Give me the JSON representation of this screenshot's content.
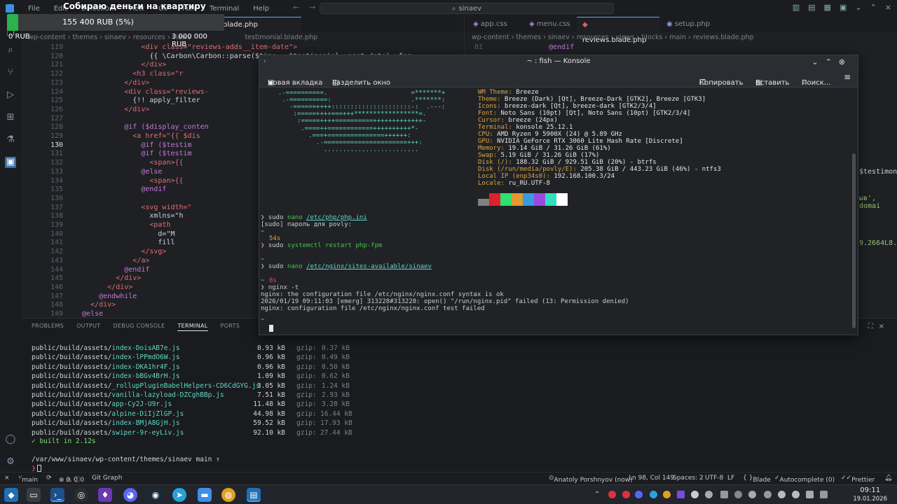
{
  "titlebar": {
    "menu": [
      "File",
      "Edit",
      "Selection",
      "View",
      "Go",
      "Run",
      "Terminal",
      "Help"
    ],
    "command_center": "sinaev"
  },
  "donation": {
    "title": "Собираю деньги на квартиру",
    "progress_text": "155 400 RUB (5%)",
    "progress_fraction": 0.0518,
    "min": "0 RUB",
    "max": "3 000 000 RUB"
  },
  "editor_left": {
    "tab_active": "testimonial.blade.php",
    "tab_partial": "blade.php",
    "breadcrumb": [
      "wp-content",
      "themes",
      "sinaev",
      "resources",
      "views",
      "...",
      "testimonial.blade.php"
    ],
    "lines": [
      {
        "n": "119",
        "code": "                <div class=\"reviews-adds__item-date\">"
      },
      {
        "n": "120",
        "code": "                  {{ \\Carbon\\Carbon::parse($time,  $testimonial->post_date)->for"
      },
      {
        "n": "121",
        "code": "                </div>"
      },
      {
        "n": "122",
        "code": "              <h3 class=\"r"
      },
      {
        "n": "123",
        "code": "            </div>"
      },
      {
        "n": "124",
        "code": "            <div class=\"reviews-"
      },
      {
        "n": "125",
        "code": "              {!! apply_filter"
      },
      {
        "n": "126",
        "code": "            </div>"
      },
      {
        "n": "127",
        "code": ""
      },
      {
        "n": "128",
        "code": "            @if ($display_conten"
      },
      {
        "n": "129",
        "code": "              <a href=\"{{ $dis"
      },
      {
        "n": "130",
        "code": "                @if ($testim"
      },
      {
        "n": "131",
        "code": "                @if ($testim"
      },
      {
        "n": "132",
        "code": "                  <span>{{"
      },
      {
        "n": "133",
        "code": "                @else"
      },
      {
        "n": "134",
        "code": "                  <span>{{"
      },
      {
        "n": "135",
        "code": "                @endif"
      },
      {
        "n": "136",
        "code": ""
      },
      {
        "n": "137",
        "code": "                <svg width=\""
      },
      {
        "n": "138",
        "code": "                  xmlns=\"h"
      },
      {
        "n": "139",
        "code": "                  <path"
      },
      {
        "n": "140",
        "code": "                    d=\"M"
      },
      {
        "n": "141",
        "code": "                    fill"
      },
      {
        "n": "142",
        "code": "                </svg>"
      },
      {
        "n": "143",
        "code": "              </a>"
      },
      {
        "n": "144",
        "code": "            @endif"
      },
      {
        "n": "145",
        "code": "          </div>"
      },
      {
        "n": "146",
        "code": "        </div>"
      },
      {
        "n": "147",
        "code": "      @endwhile"
      },
      {
        "n": "148",
        "code": "    </div>"
      },
      {
        "n": "149",
        "code": "  @else"
      }
    ]
  },
  "editor_right": {
    "tabs": [
      "app.css",
      "menu.css",
      "reviews.blade.php",
      "setup.php"
    ],
    "active_tab": "reviews.blade.php",
    "breadcrumb": [
      "wp-content",
      "themes",
      "sinaev",
      "resources",
      "views",
      "blocks",
      "main",
      "reviews.blade.php"
    ],
    "line_81_n": "81",
    "line_81": "@endif",
    "fragment_1": "$testimoni",
    "fragment_2": "ыв', domai",
    "fragment_3": "9.2664L8.4"
  },
  "panel": {
    "tabs": [
      "PROBLEMS",
      "OUTPUT",
      "DEBUG CONSOLE",
      "TERMINAL",
      "PORTS"
    ],
    "active_tab": "TERMINAL",
    "build_rows": [
      {
        "dir": "public/build/assets/",
        "file": "index-DoisAB7e.js",
        "size": "0.93 kB",
        "gzip": "0.37 kB"
      },
      {
        "dir": "public/build/assets/",
        "file": "index-lPPmdO6W.js",
        "size": "0.96 kB",
        "gzip": "0.49 kB"
      },
      {
        "dir": "public/build/assets/",
        "file": "index-DKA1hr4F.js",
        "size": "0.96 kB",
        "gzip": "0.50 kB"
      },
      {
        "dir": "public/build/assets/",
        "file": "index-bBGv4BrH.js",
        "size": "1.09 kB",
        "gzip": "0.62 kB"
      },
      {
        "dir": "public/build/assets/",
        "file": "_rollupPluginBabelHelpers-CD6CdGYG.js",
        "size": "3.05 kB",
        "gzip": "1.24 kB"
      },
      {
        "dir": "public/build/assets/",
        "file": "vanilla-lazyload-DZCghBBp.js",
        "size": "7.51 kB",
        "gzip": "2.93 kB"
      },
      {
        "dir": "public/build/assets/",
        "file": "app-Cy2J-U9r.js",
        "size": "11.48 kB",
        "gzip": "3.28 kB"
      },
      {
        "dir": "public/build/assets/",
        "file": "alpine-DiIjZlGP.js",
        "size": "44.98 kB",
        "gzip": "16.44 kB"
      },
      {
        "dir": "public/build/assets/",
        "file": "index-BMjA8GjH.js",
        "size": "59.52 kB",
        "gzip": "17.93 kB"
      },
      {
        "dir": "public/build/assets/",
        "file": "swiper-9r-eyLiv.js",
        "size": "92.10 kB",
        "gzip": "27.44 kB"
      }
    ],
    "gzip_label": "gzip:",
    "built": "✓ built in 2.12s",
    "cwd": "/var/www/sinaev/wp-content/themes/sinaev main ↑",
    "prompt": "❯"
  },
  "konsole": {
    "title": "~ : fish — Konsole",
    "toolbar": {
      "new_tab": "Новая вкладка",
      "split": "Разделить окно",
      "copy": "Копировать",
      "paste": "Вставить",
      "search": "Поиск..."
    },
    "ascii": [
      "  .-==========.                      =*******+",
      "   .-==========:                     .*******:",
      "     -======++++:::::::::::::::::::::-:  .---:",
      "      :=====++++===+++*****************=.",
      "       :=====++++==========+++++++++++++-",
      "        .====++============++++++++++*-",
      "          .===+===============++++++:",
      "            .-======================+++:",
      "              ........................."
    ],
    "fastfetch": [
      {
        "k": "WM Theme:",
        "v": "Breeze"
      },
      {
        "k": "Theme:",
        "v": "Breeze (Dark) [Qt], Breeze-Dark [GTK2], Breeze [GTK3]"
      },
      {
        "k": "Icons:",
        "v": "breeze-dark [Qt], breeze-dark [GTK2/3/4]"
      },
      {
        "k": "Font:",
        "v": "Noto Sans (10pt) [Qt], Noto Sans (10pt) [GTK2/3/4]"
      },
      {
        "k": "Cursor:",
        "v": "breeze (24px)"
      },
      {
        "k": "Terminal:",
        "v": "konsole 25.12.1"
      },
      {
        "k": "CPU:",
        "v": "AMD Ryzen 9 5900X (24) @ 5.89 GHz"
      },
      {
        "k": "GPU:",
        "v": "NVIDIA GeForce RTX 3060 Lite Hash Rate [Discrete]"
      },
      {
        "k": "Memory:",
        "v": "19.14 GiB / 31.26 GiB (61%)"
      },
      {
        "k": "Swap:",
        "v": "5.19 GiB / 31.26 GiB (17%)"
      },
      {
        "k": "Disk (/):",
        "v": "188.32 GiB / 929.51 GiB (20%) - btrfs"
      },
      {
        "k": "Disk (/run/media/povly/E):",
        "v": "205.38 GiB / 443.23 GiB (46%) - ntfs3"
      },
      {
        "k": "Local IP (enp34s0):",
        "v": "192.168.100.3/24"
      },
      {
        "k": "Locale:",
        "v": "ru_RU.UTF-8"
      }
    ],
    "palette": [
      "#808080",
      "#e0202e",
      "#2ee06e",
      "#e09a2e",
      "#3a9ae0",
      "#9a4ae0",
      "#2ee0c0",
      "#ffffff"
    ],
    "session": {
      "cmd1": "sudo nano /etc/php/php.ini",
      "cmd1_a": "sudo",
      "cmd1_b": "nano",
      "cmd1_c": "/etc/php/php.ini",
      "sudo_prompt": "[sudo] пароль для povly:",
      "tilde": "~",
      "dur1": "54s",
      "cmd2": "sudo systemctl restart php-fpm",
      "cmd2_a": "sudo",
      "cmd2_b": "systemctl restart php-fpm",
      "cmd3_a": "sudo",
      "cmd3_b": "nano",
      "cmd3_c": "/etc/nginx/sites-available/sinaev",
      "dur2": "8s",
      "cmd4": "nginx -t",
      "out1": "nginx: the configuration file /etc/nginx/nginx.conf syntax is ok",
      "out2": "2026/01/19 09:11:03 [emerg] 313228#313228: open() \"/run/nginx.pid\" failed (13: Permission denied)",
      "out3": "nginx: configuration file /etc/nginx/nginx.conf test failed",
      "arrow": "❯"
    }
  },
  "statusbar": {
    "branch": "main",
    "errors": "0",
    "warnings": "0",
    "info": "0",
    "git_graph": "Git Graph",
    "blame": "Anatoly Porshnyov (now)",
    "position": "Ln 98, Col 149",
    "spaces": "Spaces: 2",
    "encoding": "UTF-8",
    "eol": "LF",
    "language": "Blade",
    "autocomplete": "Autocomplete (0)",
    "prettier": "Prettier"
  },
  "taskbar": {
    "time": "09:11",
    "date": "19.01.2026"
  },
  "colors": {
    "accent": "#6aa0ff",
    "progress": "#2bb34a",
    "teal": "#5fd7c7",
    "error": "#e05050",
    "key": "#d9a640"
  }
}
